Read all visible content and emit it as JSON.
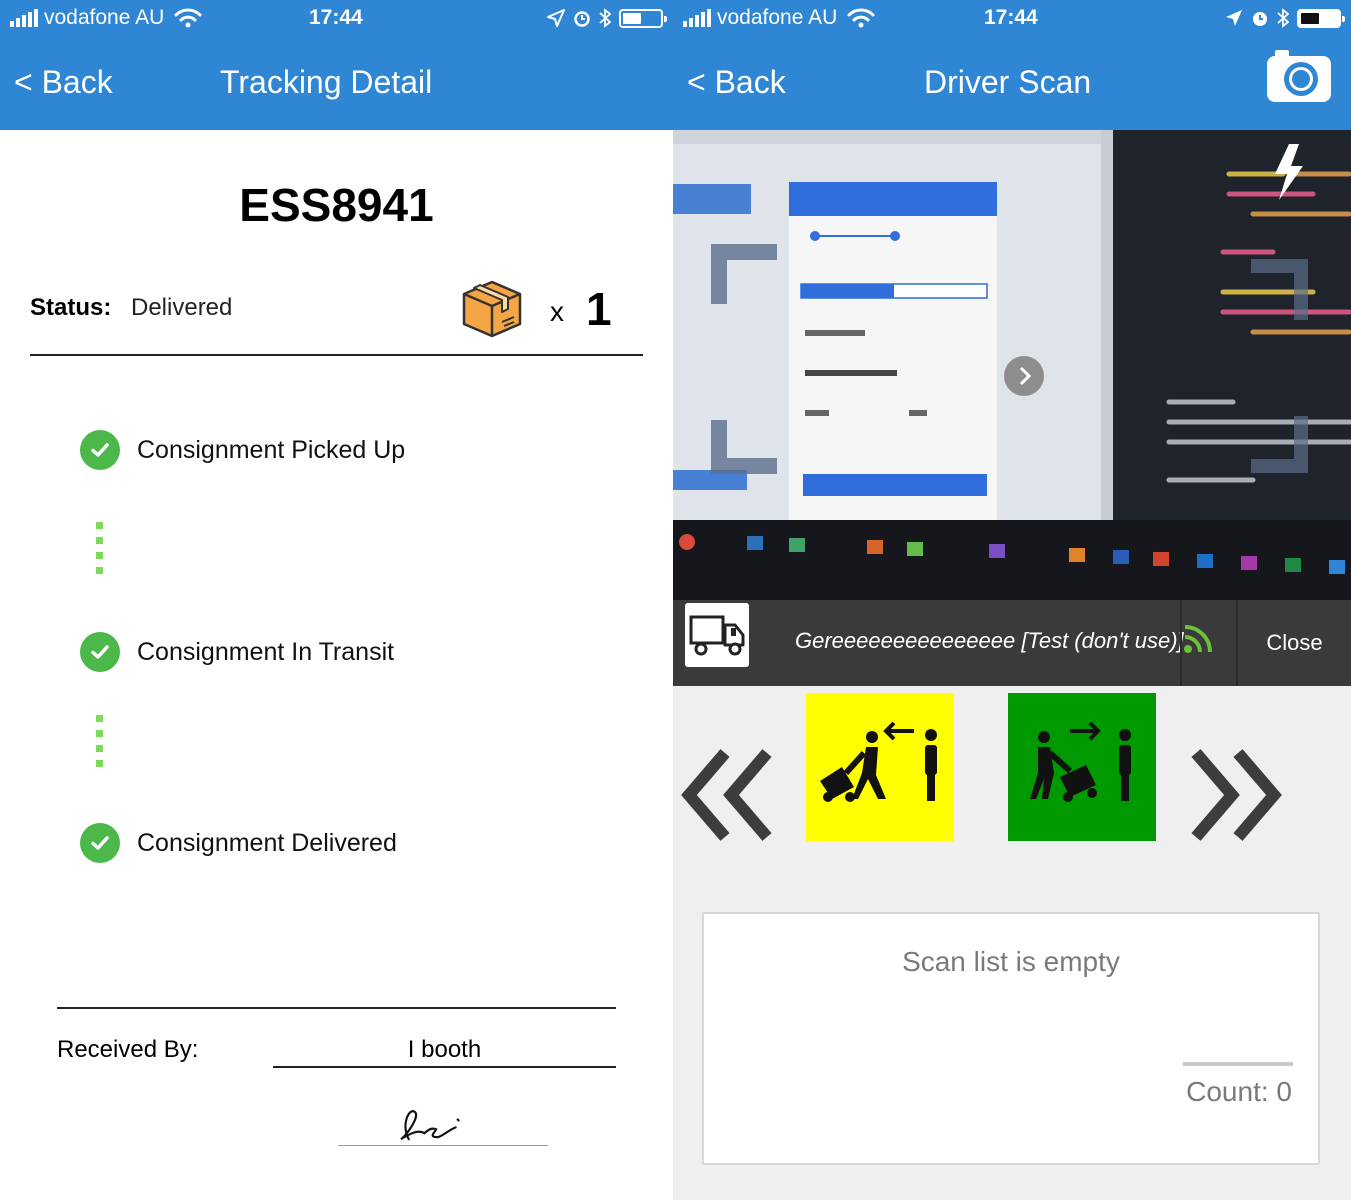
{
  "status_bar": {
    "carrier": "vodafone AU",
    "time": "17:44"
  },
  "tracking_screen": {
    "nav": {
      "back_label": "< Back",
      "title": "Tracking Detail"
    },
    "tracking_id": "ESS8941",
    "status": {
      "label": "Status:",
      "value": "Delivered",
      "package_icon": "package-box-icon",
      "qty_prefix": "x",
      "qty": "1"
    },
    "steps": [
      {
        "label": "Consignment Picked Up",
        "icon": "check-circle-icon"
      },
      {
        "label": "Consignment In Transit",
        "icon": "check-circle-icon"
      },
      {
        "label": "Consignment Delivered",
        "icon": "check-circle-icon"
      }
    ],
    "received_by": {
      "label": "Received By:",
      "value": "I booth"
    }
  },
  "scan_screen": {
    "nav": {
      "back_label": "< Back",
      "title": "Driver Scan",
      "action_icon": "camera-icon"
    },
    "driver_bar": {
      "icon": "truck-icon",
      "name": "Gereeeeeeeeeeeeeee [Test (don't use)]",
      "signal_icon": "rss-icon",
      "close_label": "Close"
    },
    "modes": [
      {
        "name": "pickup-mode",
        "color": "#ffff00"
      },
      {
        "name": "dropoff-mode",
        "color": "#009900"
      }
    ],
    "scan_list": {
      "empty_text": "Scan list is empty",
      "count_label": "Count: 0"
    }
  },
  "colors": {
    "header_blue": "#2f86d4",
    "success_green": "#4cb849",
    "dotted_green": "#7ed85a"
  }
}
